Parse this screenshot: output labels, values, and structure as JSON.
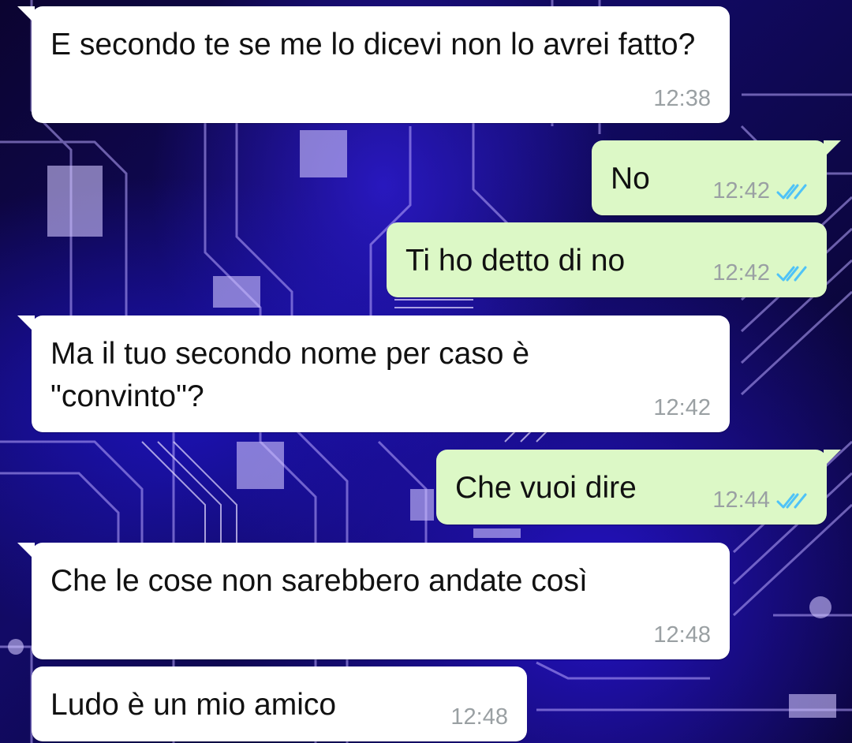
{
  "chat": {
    "colors": {
      "incoming_bubble": "#ffffff",
      "outgoing_bubble": "#dcf8c6",
      "timestamp": "#9aa0a3",
      "read_ticks": "#4fc3f7"
    },
    "messages": [
      {
        "direction": "in",
        "text": "E secondo te se me lo dicevi non lo avrei fatto?",
        "time": "12:38"
      },
      {
        "direction": "out",
        "text": "No",
        "time": "12:42",
        "status": "read"
      },
      {
        "direction": "out",
        "text": "Ti ho detto di no",
        "time": "12:42",
        "status": "read"
      },
      {
        "direction": "in",
        "text": "Ma il tuo secondo nome per caso è \"convinto\"?",
        "time": "12:42"
      },
      {
        "direction": "out",
        "text": "Che vuoi dire",
        "time": "12:44",
        "status": "read"
      },
      {
        "direction": "in",
        "text": "Che le cose non sarebbero andate così",
        "time": "12:48"
      },
      {
        "direction": "in",
        "text": "Ludo è un mio amico",
        "time": "12:48"
      }
    ]
  }
}
